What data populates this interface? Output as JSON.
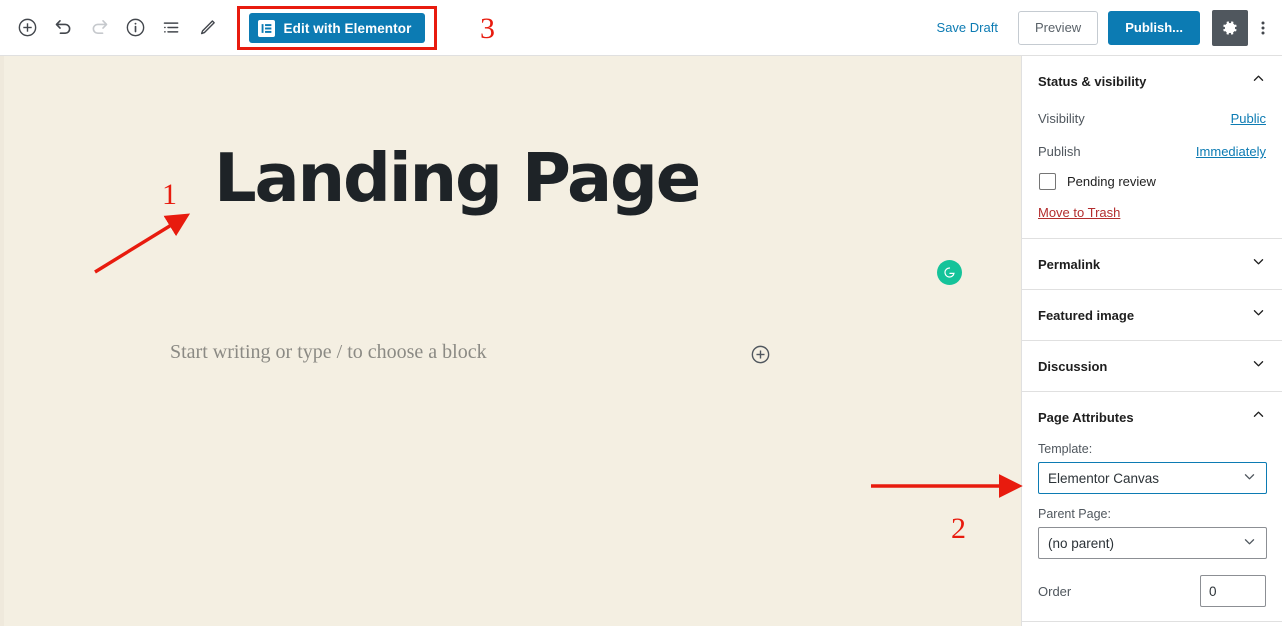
{
  "toolbar": {
    "icons": [
      {
        "name": "add-block-icon",
        "label": "Add block"
      },
      {
        "name": "undo-icon",
        "label": "Undo"
      },
      {
        "name": "redo-icon",
        "label": "Redo"
      },
      {
        "name": "info-icon",
        "label": "Details"
      },
      {
        "name": "list-view-icon",
        "label": "List view"
      },
      {
        "name": "edit-pencil-icon",
        "label": "Edit"
      }
    ],
    "elementor_button_label": "Edit with Elementor",
    "save_draft_label": "Save Draft",
    "preview_label": "Preview",
    "publish_label": "Publish...",
    "settings_gear_label": "Settings",
    "more_options_label": "Options"
  },
  "editor": {
    "post_title": "Landing Page",
    "block_placeholder": "Start writing or type / to choose a block",
    "grammarly_label": "G"
  },
  "sidebar": {
    "panels": [
      {
        "title": "Status & visibility",
        "expanded": true,
        "rows": [
          {
            "label": "Visibility",
            "value": "Public"
          },
          {
            "label": "Publish",
            "value": "Immediately"
          }
        ],
        "checkbox_label": "Pending review",
        "trash_label": "Move to Trash"
      },
      {
        "title": "Permalink",
        "expanded": false
      },
      {
        "title": "Featured image",
        "expanded": false
      },
      {
        "title": "Discussion",
        "expanded": false
      },
      {
        "title": "Page Attributes",
        "expanded": true,
        "template_label": "Template:",
        "template_value": "Elementor Canvas",
        "parent_label": "Parent Page:",
        "parent_value": "(no parent)",
        "order_label": "Order",
        "order_value": "0"
      }
    ]
  },
  "annotations": [
    {
      "number": "1",
      "target": "post-title"
    },
    {
      "number": "2",
      "target": "template-select"
    },
    {
      "number": "3",
      "target": "elementor-button"
    }
  ],
  "colors": {
    "accent_blue": "#0c7bb3",
    "annotation_red": "#e81b0e",
    "canvas_cream": "#f4efe2",
    "trash_red": "#b32d2e",
    "grammarly_green": "#15c39a",
    "gear_gray": "#50575e"
  }
}
